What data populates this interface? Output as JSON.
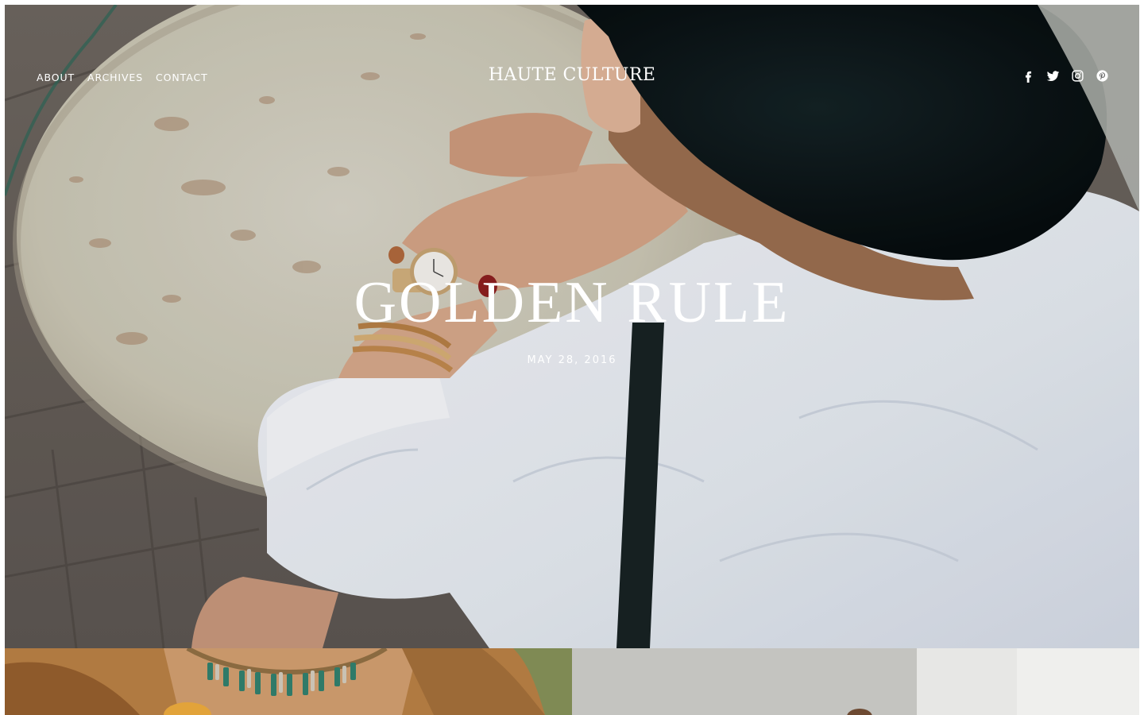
{
  "site": {
    "logo": "HAUTE CULTURE"
  },
  "nav": {
    "items": [
      {
        "label": "ABOUT"
      },
      {
        "label": "ARCHIVES"
      },
      {
        "label": "CONTACT"
      }
    ]
  },
  "social": {
    "icons": [
      "facebook-icon",
      "twitter-icon",
      "instagram-icon",
      "pinterest-icon"
    ]
  },
  "hero": {
    "title": "GOLDEN RULE",
    "date": "MAY 28, 2016",
    "image": "woman-with-wristwatch-at-stone-table-photo"
  },
  "posts": [
    {
      "image": "necklace-and-suede-jacket-photo"
    },
    {
      "image": "woman-by-white-wall-photo"
    }
  ],
  "colors": {
    "text_on_image": "#ffffff",
    "jacket_tan": "#b07a41",
    "hat_black": "#0b1416"
  }
}
